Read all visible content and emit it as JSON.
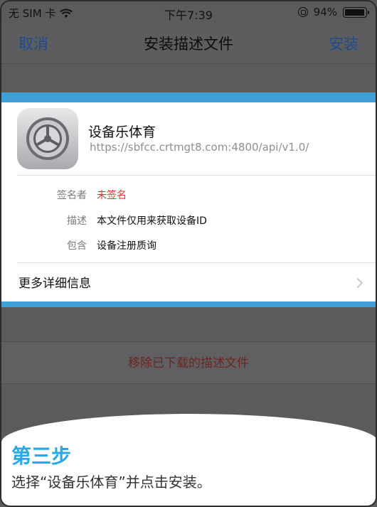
{
  "status_bar": {
    "carrier": "无 SIM 卡",
    "time": "下午7:39",
    "battery": "94%",
    "battery_level": 0.94
  },
  "nav": {
    "cancel_label": "取消",
    "title": "安装描述文件",
    "install_label": "安装"
  },
  "profile": {
    "name": "设备乐体育",
    "url": "https://sbfcc.crtmgt8.com:4800/api/v1.0/",
    "icon": "settings-gear-icon",
    "fields": [
      {
        "label": "签名者",
        "value": "未签名",
        "color": "#e1332b"
      },
      {
        "label": "描述",
        "value": "本文件仅用来获取设备ID"
      },
      {
        "label": "包含",
        "value": "设备注册质询"
      }
    ],
    "more_details": "更多详细信息"
  },
  "remove_label": "移除已下载的描述文件",
  "instruction": {
    "title": "第三步",
    "text": "选择“设备乐体育”并点击安装。"
  },
  "colors": {
    "accent": "#27a8e8",
    "nav_link": "#1f4a8c",
    "danger": "#e1332b"
  }
}
